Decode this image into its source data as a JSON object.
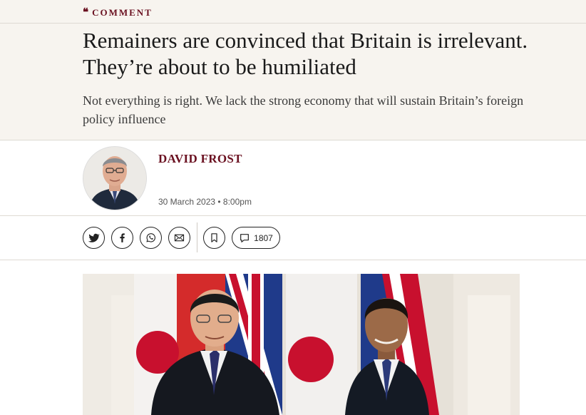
{
  "section": {
    "quote_glyph": "❝",
    "label": "COMMENT"
  },
  "article": {
    "headline": "Remainers are convinced that Britain is irrelevant. They’re about to be humiliated",
    "standfirst": "Not everything is right. We lack the strong economy that will sustain Britain’s foreign policy influence"
  },
  "byline": {
    "author": "DAVID FROST",
    "date": "30 March 2023 • 8:00pm"
  },
  "share": {
    "icons": [
      "twitter-icon",
      "facebook-icon",
      "whatsapp-icon",
      "email-icon",
      "bookmark-icon",
      "comment-icon"
    ],
    "comment_count": "1807"
  },
  "colors": {
    "accent": "#6a1020",
    "band_background": "#f7f4ef",
    "text": "#1a1a1a"
  }
}
